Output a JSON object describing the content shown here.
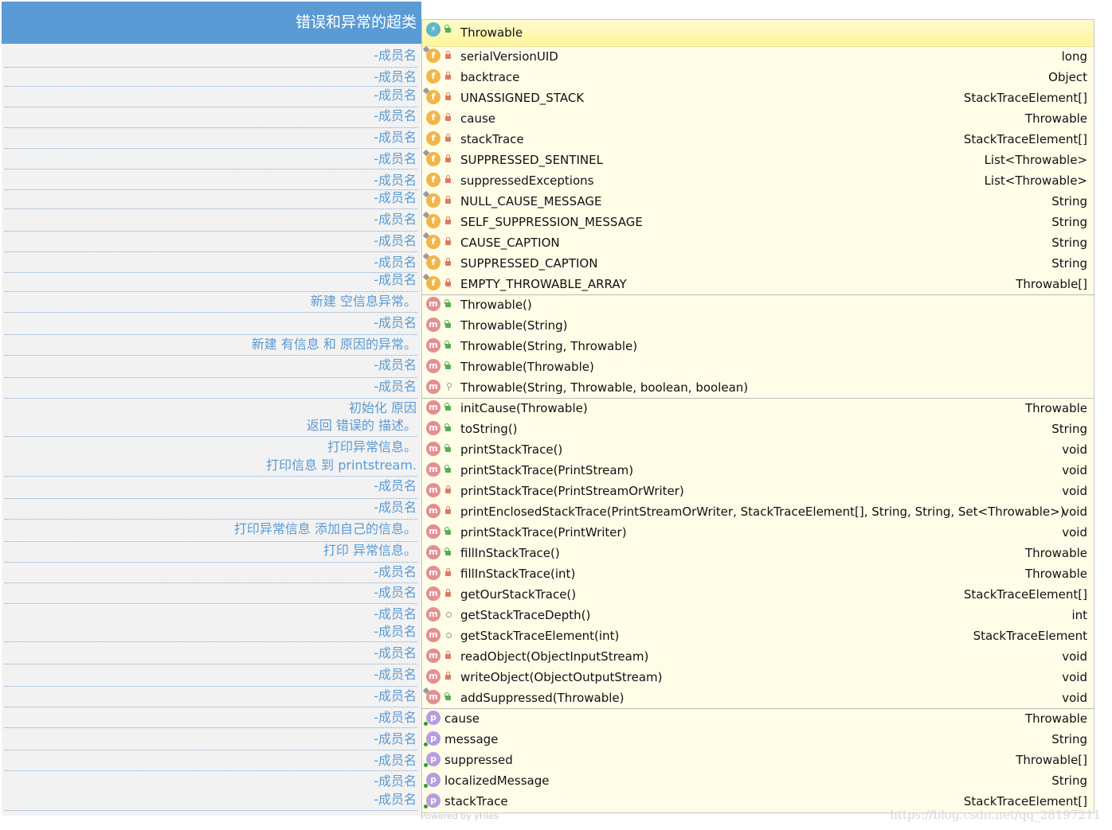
{
  "left_panel": {
    "header": "错误和异常的超类",
    "accent_color": "#5a9bd5",
    "notes": [
      "-成员名",
      "-成员名",
      "-成员名",
      "-成员名",
      "-成员名",
      "-成员名",
      "-成员名",
      "-成员名",
      "-成员名",
      "-成员名",
      "-成员名",
      "-成员名",
      "新建 空信息异常。",
      "-成员名",
      "新建 有信息 和 原因的异常。",
      "-成员名",
      "-成员名",
      "初始化 原因",
      "返回 错误的 描述。",
      "打印异常信息。",
      "打印信息 到 printstream.",
      "-成员名",
      "-成员名",
      "打印异常信息 添加自己的信息。",
      "打印 异常信息。",
      "-成员名",
      "-成员名",
      "-成员名",
      "-成员名",
      "-成员名",
      "-成员名",
      "-成员名",
      "-成员名",
      "-成员名",
      "-成员名",
      "-成员名",
      "-成员名"
    ]
  },
  "class": {
    "name": "Throwable",
    "header_icon": "class-icon",
    "fields": [
      {
        "name": "serialVersionUID",
        "type": "long",
        "static": true,
        "visibility": "private"
      },
      {
        "name": "backtrace",
        "type": "Object",
        "static": false,
        "visibility": "private"
      },
      {
        "name": "UNASSIGNED_STACK",
        "type": "StackTraceElement[]",
        "static": true,
        "visibility": "private"
      },
      {
        "name": "cause",
        "type": "Throwable",
        "static": false,
        "visibility": "private"
      },
      {
        "name": "stackTrace",
        "type": "StackTraceElement[]",
        "static": false,
        "visibility": "private"
      },
      {
        "name": "SUPPRESSED_SENTINEL",
        "type": "List<Throwable>",
        "static": true,
        "visibility": "private"
      },
      {
        "name": "suppressedExceptions",
        "type": "List<Throwable>",
        "static": false,
        "visibility": "private"
      },
      {
        "name": "NULL_CAUSE_MESSAGE",
        "type": "String",
        "static": true,
        "visibility": "private"
      },
      {
        "name": "SELF_SUPPRESSION_MESSAGE",
        "type": "String",
        "static": true,
        "visibility": "private"
      },
      {
        "name": "CAUSE_CAPTION",
        "type": "String",
        "static": true,
        "visibility": "private"
      },
      {
        "name": "SUPPRESSED_CAPTION",
        "type": "String",
        "static": true,
        "visibility": "private"
      },
      {
        "name": "EMPTY_THROWABLE_ARRAY",
        "type": "Throwable[]",
        "static": true,
        "visibility": "private"
      }
    ],
    "constructors": [
      {
        "name": "Throwable()",
        "type": "",
        "visibility": "public"
      },
      {
        "name": "Throwable(String)",
        "type": "",
        "visibility": "public"
      },
      {
        "name": "Throwable(String, Throwable)",
        "type": "",
        "visibility": "public"
      },
      {
        "name": "Throwable(Throwable)",
        "type": "",
        "visibility": "public"
      },
      {
        "name": "Throwable(String, Throwable, boolean, boolean)",
        "type": "",
        "visibility": "protected"
      }
    ],
    "methods": [
      {
        "name": "initCause(Throwable)",
        "type": "Throwable",
        "static": false,
        "visibility": "public"
      },
      {
        "name": "toString()",
        "type": "String",
        "static": false,
        "visibility": "public"
      },
      {
        "name": "printStackTrace()",
        "type": "void",
        "static": false,
        "visibility": "public"
      },
      {
        "name": "printStackTrace(PrintStream)",
        "type": "void",
        "static": false,
        "visibility": "public"
      },
      {
        "name": "printStackTrace(PrintStreamOrWriter)",
        "type": "void",
        "static": false,
        "visibility": "private"
      },
      {
        "name": "printEnclosedStackTrace(PrintStreamOrWriter, StackTraceElement[], String, String, Set<Throwable>)",
        "type": "void",
        "static": false,
        "visibility": "private"
      },
      {
        "name": "printStackTrace(PrintWriter)",
        "type": "void",
        "static": false,
        "visibility": "public"
      },
      {
        "name": "fillInStackTrace()",
        "type": "Throwable",
        "static": false,
        "visibility": "public"
      },
      {
        "name": "fillInStackTrace(int)",
        "type": "Throwable",
        "static": false,
        "visibility": "private"
      },
      {
        "name": "getOurStackTrace()",
        "type": "StackTraceElement[]",
        "static": false,
        "visibility": "private"
      },
      {
        "name": "getStackTraceDepth()",
        "type": "int",
        "static": false,
        "visibility": "package"
      },
      {
        "name": "getStackTraceElement(int)",
        "type": "StackTraceElement",
        "static": false,
        "visibility": "package"
      },
      {
        "name": "readObject(ObjectInputStream)",
        "type": "void",
        "static": false,
        "visibility": "private"
      },
      {
        "name": "writeObject(ObjectOutputStream)",
        "type": "void",
        "static": false,
        "visibility": "private"
      },
      {
        "name": "addSuppressed(Throwable)",
        "type": "void",
        "static": true,
        "visibility": "public"
      }
    ],
    "properties": [
      {
        "name": "cause",
        "type": "Throwable"
      },
      {
        "name": "message",
        "type": "String"
      },
      {
        "name": "suppressed",
        "type": "Throwable[]"
      },
      {
        "name": "localizedMessage",
        "type": "String"
      },
      {
        "name": "stackTrace",
        "type": "StackTraceElement[]"
      }
    ],
    "icon_letters": {
      "field": "f",
      "method": "m",
      "property": "p"
    }
  },
  "footer": {
    "credit": "Powered by yFiles",
    "watermark": "https://blog.csdn.net/qq_28197211"
  }
}
